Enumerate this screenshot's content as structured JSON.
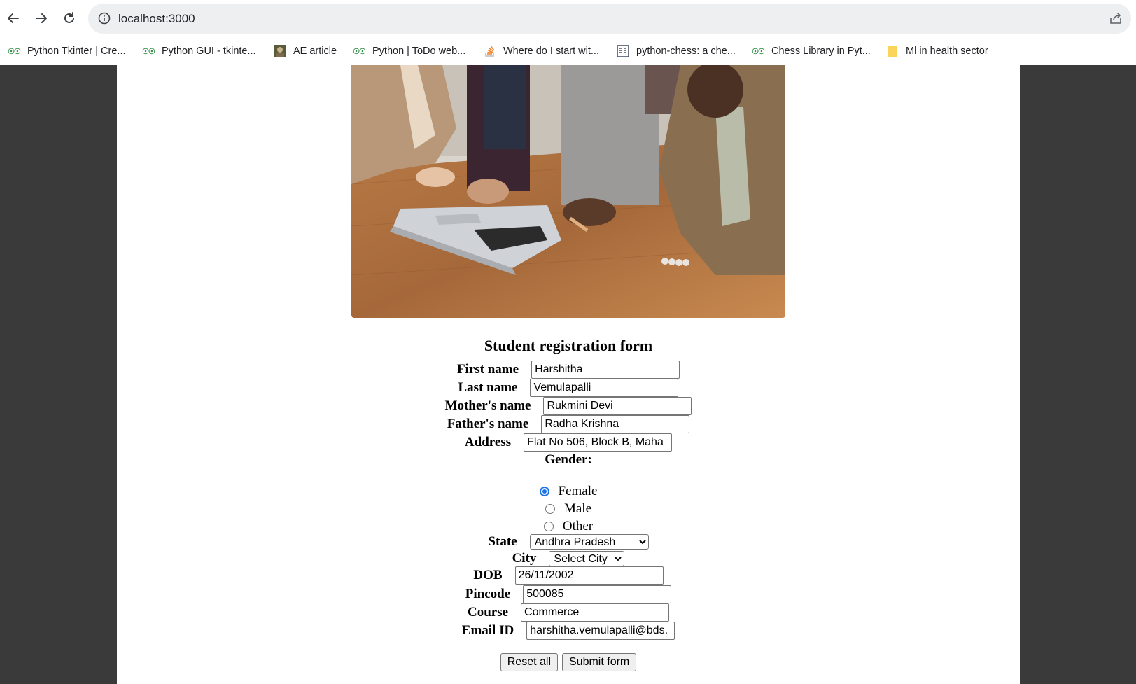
{
  "browser": {
    "url": "localhost:3000",
    "bookmarks": [
      {
        "label": "Python Tkinter | Cre...",
        "icon": "geeksforgeeks-icon"
      },
      {
        "label": "Python GUI - tkinte...",
        "icon": "geeksforgeeks-icon"
      },
      {
        "label": "AE article",
        "icon": "profile-photo-icon"
      },
      {
        "label": "Python | ToDo web...",
        "icon": "geeksforgeeks-icon"
      },
      {
        "label": "Where do I start wit...",
        "icon": "stackoverflow-icon"
      },
      {
        "label": "python-chess: a che...",
        "icon": "document-icon"
      },
      {
        "label": "Chess Library in Pyt...",
        "icon": "geeksforgeeks-icon"
      },
      {
        "label": "Ml in health sector",
        "icon": "folder-icon"
      }
    ]
  },
  "form": {
    "title": "Student registration form",
    "first_name": {
      "label": "First name",
      "value": "Harshitha"
    },
    "last_name": {
      "label": "Last name",
      "value": "Vemulapalli"
    },
    "mother_name": {
      "label": "Mother's name",
      "value": "Rukmini Devi"
    },
    "father_name": {
      "label": "Father's name",
      "value": "Radha Krishna"
    },
    "address": {
      "label": "Address",
      "value": "Flat No 506, Block B, Maha"
    },
    "gender": {
      "label": "Gender:",
      "options": [
        "Female",
        "Male",
        "Other"
      ],
      "selected": "Female"
    },
    "state": {
      "label": "State",
      "value": "Andhra Pradesh"
    },
    "city": {
      "label": "City",
      "value": "Select City"
    },
    "dob": {
      "label": "DOB",
      "value": "26/11/2002"
    },
    "pincode": {
      "label": "Pincode",
      "value": "500085"
    },
    "course": {
      "label": "Course",
      "value": "Commerce"
    },
    "email": {
      "label": "Email ID",
      "value": "harshitha.vemulapalli@bds."
    },
    "reset_label": "Reset all",
    "submit_label": "Submit form"
  },
  "colors": {
    "page_bg": "#3a3a3a",
    "radio_accent": "#1a73e8"
  }
}
